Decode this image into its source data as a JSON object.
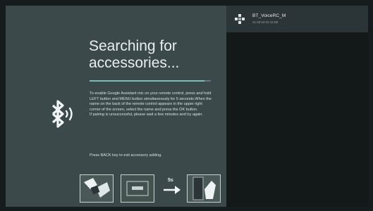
{
  "screen": {
    "title": "Searching for accessories...",
    "progress_fraction": 0.95,
    "instructions": [
      "To enable Google Assistant mic on your remote control, press and hold LEFT button and MENU button simultaneously for 5 seconds.When the name on the back of the remote control appears in the upper right corner of the screen, select the name and press the OK button.",
      "If pairing is unsuccessful, please wait a few minutes and try again."
    ],
    "back_hint": "Press BACK key to exit accessory adding.",
    "step_timer": "5s",
    "icons": {
      "bluetooth": "bluetooth-signal-icon",
      "device": "remote-control-icon",
      "arrow": "arrow-right-icon"
    }
  },
  "devices": [
    {
      "name": "BT_VoiceRC_M",
      "address": "41:33:10:31:11:08"
    }
  ],
  "colors": {
    "left_panel": "#3b494b",
    "right_panel": "#131819",
    "selected_item": "#2b3537",
    "progress_fill": "#7fbcb6"
  }
}
